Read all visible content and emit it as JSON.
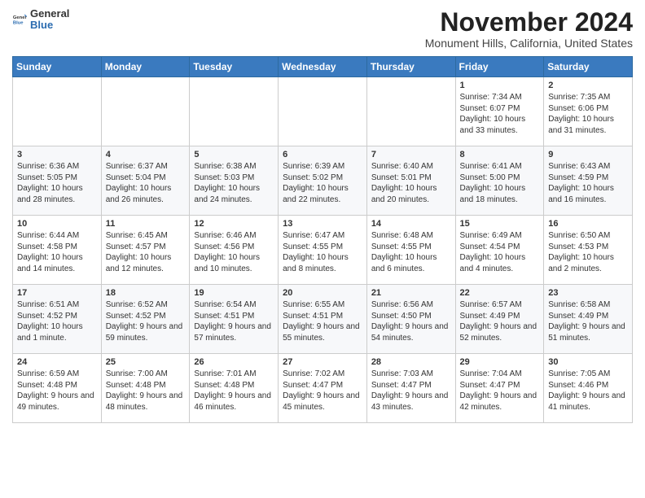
{
  "header": {
    "logo_general": "General",
    "logo_blue": "Blue",
    "month_title": "November 2024",
    "location": "Monument Hills, California, United States"
  },
  "weekdays": [
    "Sunday",
    "Monday",
    "Tuesday",
    "Wednesday",
    "Thursday",
    "Friday",
    "Saturday"
  ],
  "weeks": [
    [
      {
        "day": "",
        "info": ""
      },
      {
        "day": "",
        "info": ""
      },
      {
        "day": "",
        "info": ""
      },
      {
        "day": "",
        "info": ""
      },
      {
        "day": "",
        "info": ""
      },
      {
        "day": "1",
        "info": "Sunrise: 7:34 AM\nSunset: 6:07 PM\nDaylight: 10 hours and 33 minutes."
      },
      {
        "day": "2",
        "info": "Sunrise: 7:35 AM\nSunset: 6:06 PM\nDaylight: 10 hours and 31 minutes."
      }
    ],
    [
      {
        "day": "3",
        "info": "Sunrise: 6:36 AM\nSunset: 5:05 PM\nDaylight: 10 hours and 28 minutes."
      },
      {
        "day": "4",
        "info": "Sunrise: 6:37 AM\nSunset: 5:04 PM\nDaylight: 10 hours and 26 minutes."
      },
      {
        "day": "5",
        "info": "Sunrise: 6:38 AM\nSunset: 5:03 PM\nDaylight: 10 hours and 24 minutes."
      },
      {
        "day": "6",
        "info": "Sunrise: 6:39 AM\nSunset: 5:02 PM\nDaylight: 10 hours and 22 minutes."
      },
      {
        "day": "7",
        "info": "Sunrise: 6:40 AM\nSunset: 5:01 PM\nDaylight: 10 hours and 20 minutes."
      },
      {
        "day": "8",
        "info": "Sunrise: 6:41 AM\nSunset: 5:00 PM\nDaylight: 10 hours and 18 minutes."
      },
      {
        "day": "9",
        "info": "Sunrise: 6:43 AM\nSunset: 4:59 PM\nDaylight: 10 hours and 16 minutes."
      }
    ],
    [
      {
        "day": "10",
        "info": "Sunrise: 6:44 AM\nSunset: 4:58 PM\nDaylight: 10 hours and 14 minutes."
      },
      {
        "day": "11",
        "info": "Sunrise: 6:45 AM\nSunset: 4:57 PM\nDaylight: 10 hours and 12 minutes."
      },
      {
        "day": "12",
        "info": "Sunrise: 6:46 AM\nSunset: 4:56 PM\nDaylight: 10 hours and 10 minutes."
      },
      {
        "day": "13",
        "info": "Sunrise: 6:47 AM\nSunset: 4:55 PM\nDaylight: 10 hours and 8 minutes."
      },
      {
        "day": "14",
        "info": "Sunrise: 6:48 AM\nSunset: 4:55 PM\nDaylight: 10 hours and 6 minutes."
      },
      {
        "day": "15",
        "info": "Sunrise: 6:49 AM\nSunset: 4:54 PM\nDaylight: 10 hours and 4 minutes."
      },
      {
        "day": "16",
        "info": "Sunrise: 6:50 AM\nSunset: 4:53 PM\nDaylight: 10 hours and 2 minutes."
      }
    ],
    [
      {
        "day": "17",
        "info": "Sunrise: 6:51 AM\nSunset: 4:52 PM\nDaylight: 10 hours and 1 minute."
      },
      {
        "day": "18",
        "info": "Sunrise: 6:52 AM\nSunset: 4:52 PM\nDaylight: 9 hours and 59 minutes."
      },
      {
        "day": "19",
        "info": "Sunrise: 6:54 AM\nSunset: 4:51 PM\nDaylight: 9 hours and 57 minutes."
      },
      {
        "day": "20",
        "info": "Sunrise: 6:55 AM\nSunset: 4:51 PM\nDaylight: 9 hours and 55 minutes."
      },
      {
        "day": "21",
        "info": "Sunrise: 6:56 AM\nSunset: 4:50 PM\nDaylight: 9 hours and 54 minutes."
      },
      {
        "day": "22",
        "info": "Sunrise: 6:57 AM\nSunset: 4:49 PM\nDaylight: 9 hours and 52 minutes."
      },
      {
        "day": "23",
        "info": "Sunrise: 6:58 AM\nSunset: 4:49 PM\nDaylight: 9 hours and 51 minutes."
      }
    ],
    [
      {
        "day": "24",
        "info": "Sunrise: 6:59 AM\nSunset: 4:48 PM\nDaylight: 9 hours and 49 minutes."
      },
      {
        "day": "25",
        "info": "Sunrise: 7:00 AM\nSunset: 4:48 PM\nDaylight: 9 hours and 48 minutes."
      },
      {
        "day": "26",
        "info": "Sunrise: 7:01 AM\nSunset: 4:48 PM\nDaylight: 9 hours and 46 minutes."
      },
      {
        "day": "27",
        "info": "Sunrise: 7:02 AM\nSunset: 4:47 PM\nDaylight: 9 hours and 45 minutes."
      },
      {
        "day": "28",
        "info": "Sunrise: 7:03 AM\nSunset: 4:47 PM\nDaylight: 9 hours and 43 minutes."
      },
      {
        "day": "29",
        "info": "Sunrise: 7:04 AM\nSunset: 4:47 PM\nDaylight: 9 hours and 42 minutes."
      },
      {
        "day": "30",
        "info": "Sunrise: 7:05 AM\nSunset: 4:46 PM\nDaylight: 9 hours and 41 minutes."
      }
    ]
  ]
}
